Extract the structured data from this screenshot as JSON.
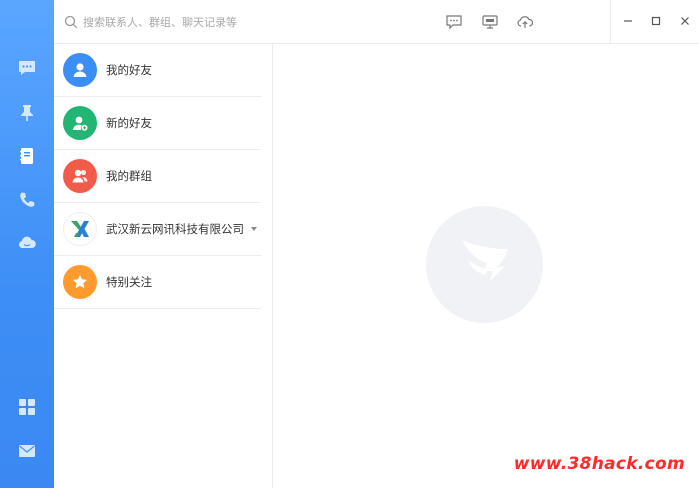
{
  "search": {
    "placeholder": "搜索联系人、群组、聊天记录等"
  },
  "rail": {
    "items": [
      {
        "icon": "chat-icon"
      },
      {
        "icon": "pin-icon"
      },
      {
        "icon": "contacts-icon"
      },
      {
        "icon": "phone-icon"
      },
      {
        "icon": "cloud-icon"
      },
      {
        "icon": "apps-grid-icon"
      },
      {
        "icon": "mail-icon"
      }
    ]
  },
  "toolbar": {
    "icons": [
      "message-icon",
      "screen-share-icon",
      "cloud-upload-icon"
    ],
    "window": [
      "minimize-icon",
      "maximize-icon",
      "close-icon"
    ]
  },
  "contacts": {
    "items": [
      {
        "label": "我的好友",
        "color": "#3a8ef6",
        "icon": "user-icon"
      },
      {
        "label": "新的好友",
        "color": "#22b573",
        "icon": "add-user-icon"
      },
      {
        "label": "我的群组",
        "color": "#f25a4a",
        "icon": "group-icon"
      },
      {
        "label": "武汉新云网讯科技有限公司",
        "color": "#ffffff",
        "icon": "company-logo-icon"
      },
      {
        "label": "特别关注",
        "color": "#ff9a2e",
        "icon": "star-icon"
      }
    ]
  },
  "watermark": {
    "text": "www.38hack.com"
  },
  "colors": {
    "rail": "#3d8ef6",
    "accent": "#3a8ef6"
  }
}
